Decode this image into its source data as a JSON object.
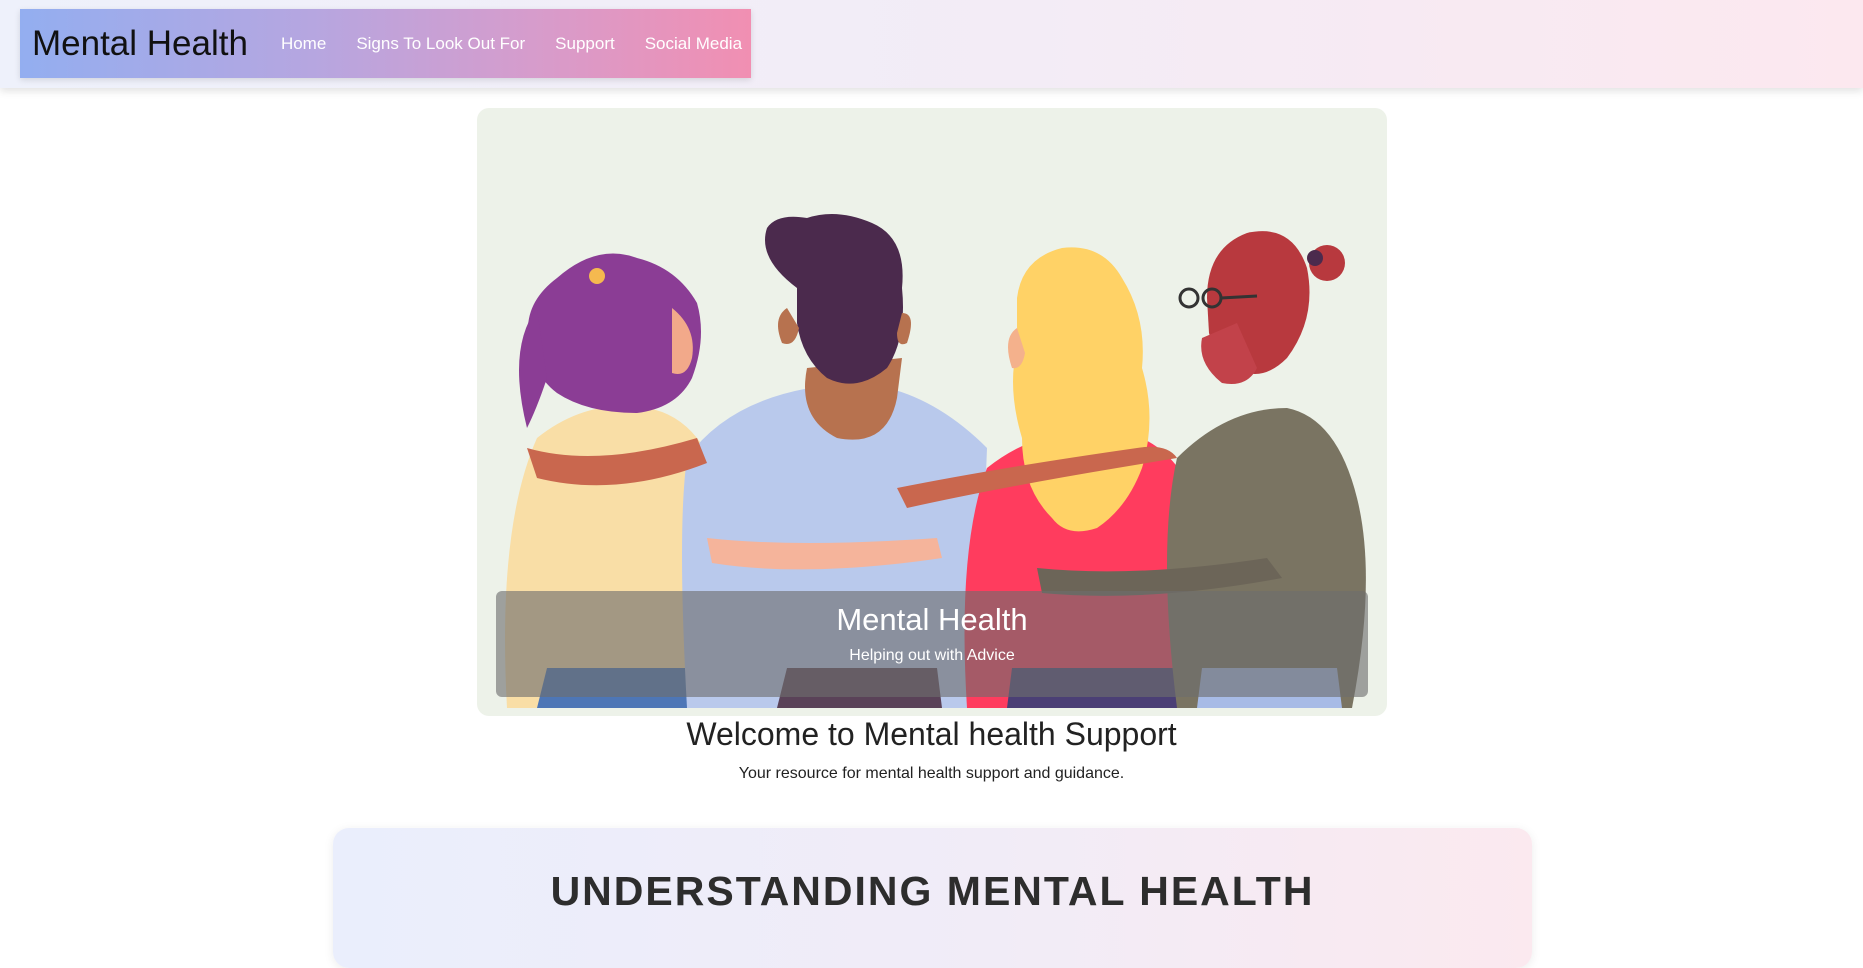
{
  "header": {
    "brand": "Mental Health",
    "nav": [
      {
        "label": "Home"
      },
      {
        "label": "Signs To Look Out For"
      },
      {
        "label": "Support"
      },
      {
        "label": "Social Media"
      }
    ]
  },
  "hero": {
    "caption_title": "Mental Health",
    "caption_subtitle": "Helping out with Advice"
  },
  "welcome": {
    "title": "Welcome to Mental health Support",
    "subtitle": "Your resource for mental health support and guidance."
  },
  "section": {
    "title": "UNDERSTANDING MENTAL HEALTH"
  },
  "colors": {
    "nav_gradient_start": "#93aef0",
    "nav_gradient_end": "#f18fb2",
    "hero_background": "#edf2e9"
  }
}
